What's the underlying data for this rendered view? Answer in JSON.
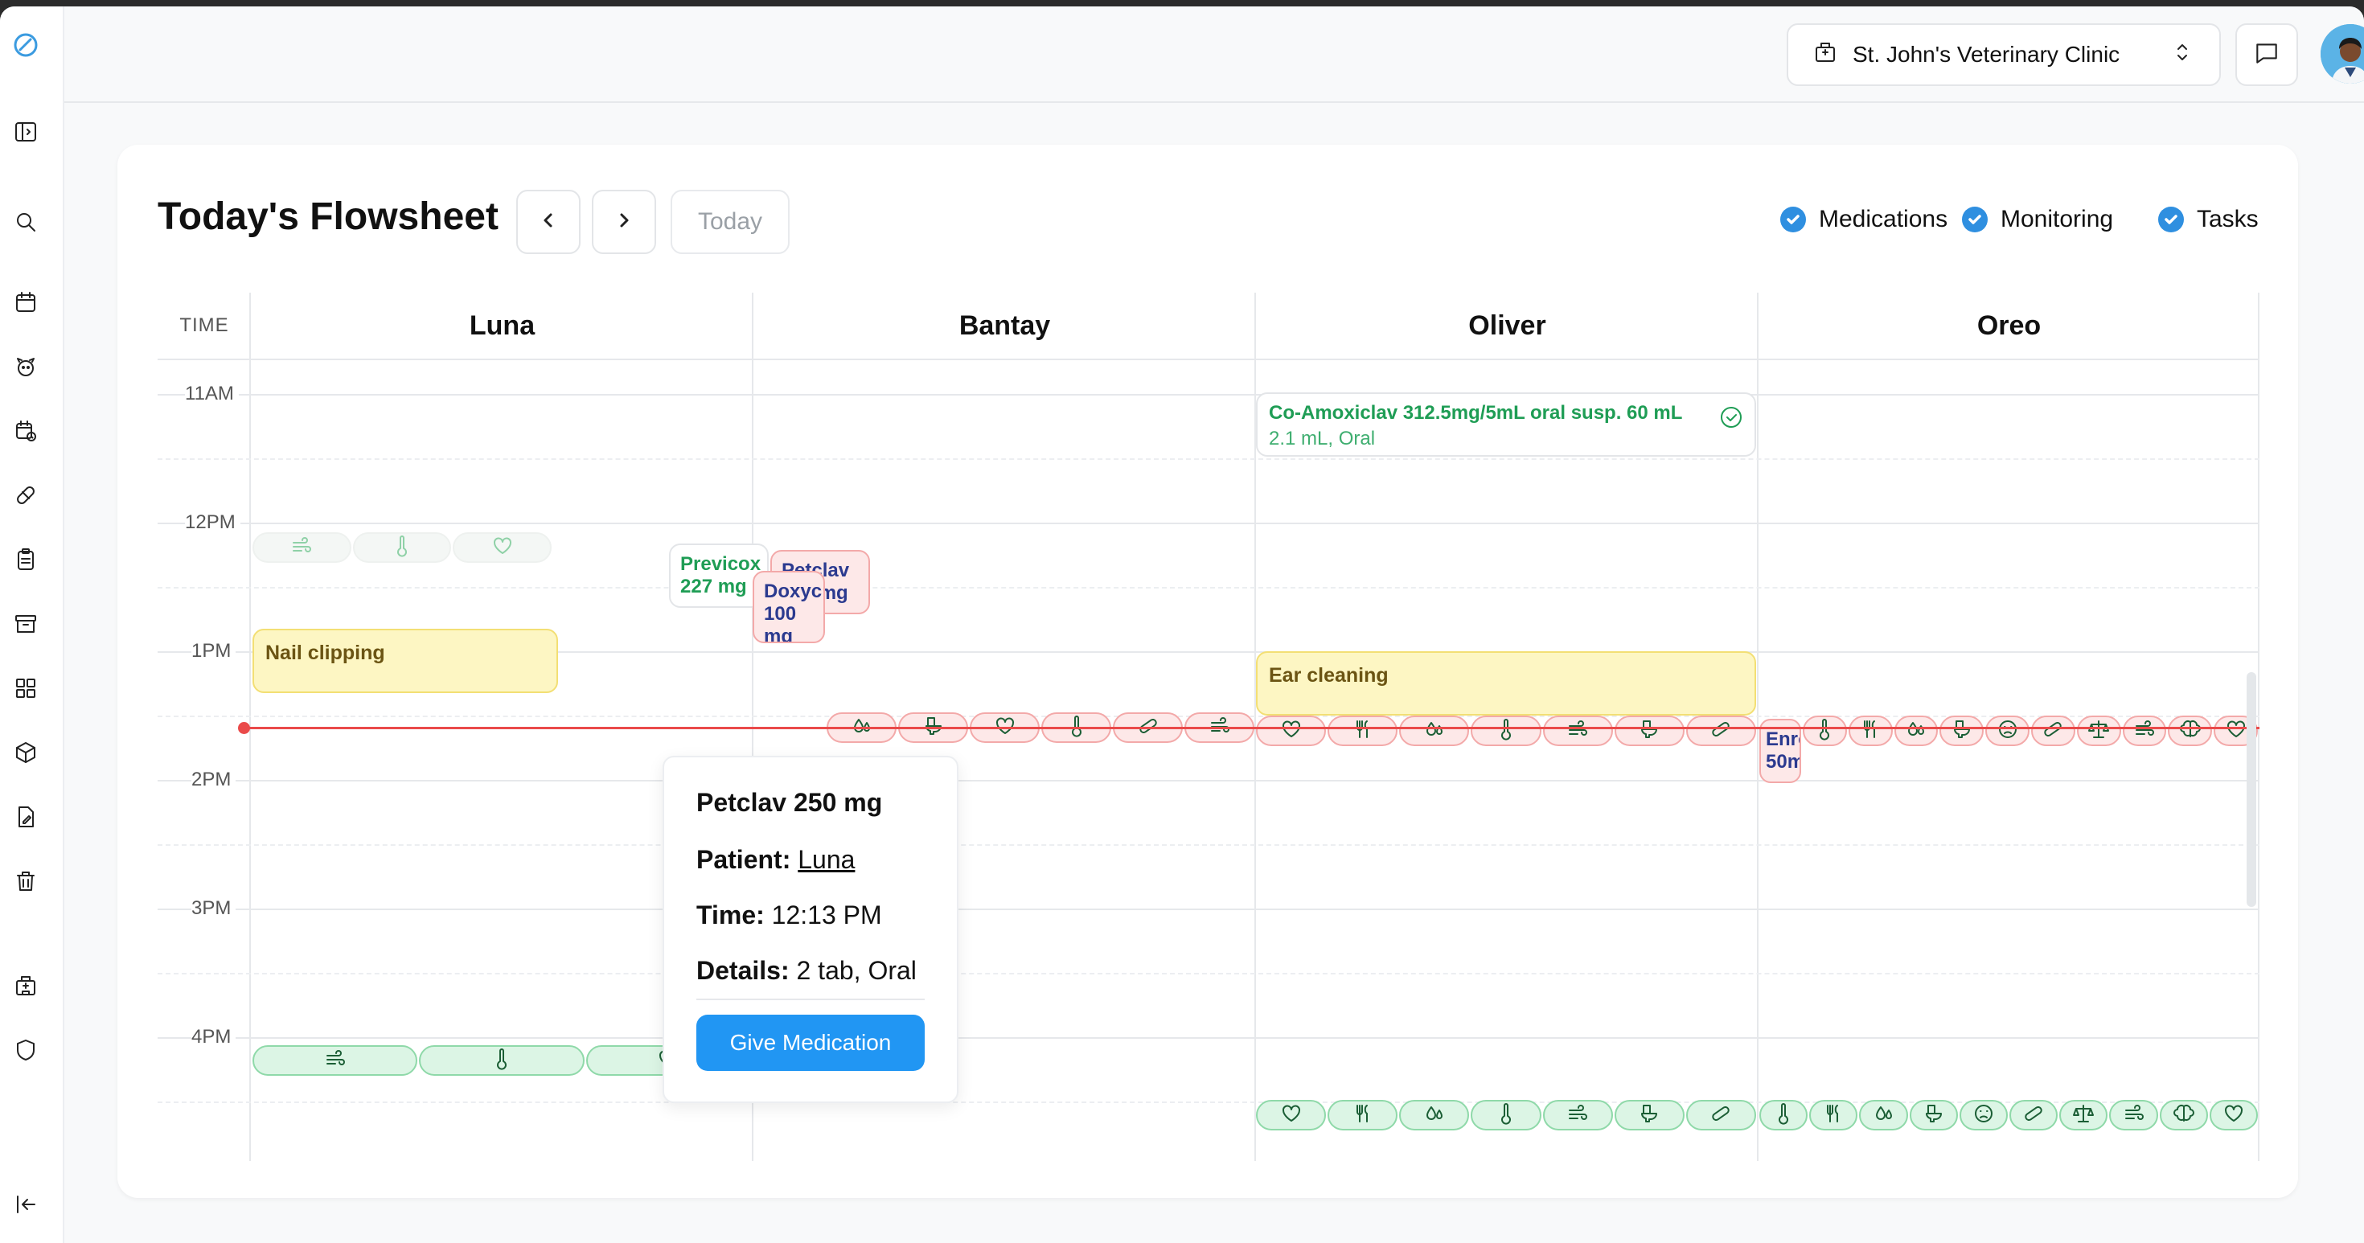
{
  "header": {
    "clinic": "St. John's Veterinary Clinic"
  },
  "page": {
    "title": "Today's Flowsheet",
    "today_label": "Today"
  },
  "filters": [
    {
      "label": "Medications",
      "checked": true
    },
    {
      "label": "Monitoring",
      "checked": true
    },
    {
      "label": "Tasks",
      "checked": true
    }
  ],
  "grid": {
    "time_header": "TIME",
    "patients": [
      "Luna",
      "Bantay",
      "Oliver",
      "Oreo"
    ],
    "times": [
      "11AM",
      "12PM",
      "1PM",
      "2PM",
      "3PM",
      "4PM"
    ]
  },
  "events": {
    "nail_clipping": "Nail clipping",
    "ear_cleaning": "Ear cleaning",
    "coamox_name": "Co-Amoxiclav 312.5mg/5mL oral susp. 60 mL",
    "coamox_detail": "2.1 mL, Oral",
    "previcox_name": "Previcox",
    "previcox_dose": "227 mg",
    "petclav_name": "Petclav",
    "petclav_dose": "250 mg",
    "doxy_name": "Doxyc",
    "doxy_dose": "100 mg",
    "enro_name": "Enro",
    "enro_dose": "50m"
  },
  "popover": {
    "title": "Petclav 250 mg",
    "patient_label": "Patient:",
    "patient_value": "Luna",
    "time_label": "Time:",
    "time_value": "12:13 PM",
    "details_label": "Details:",
    "details_value": "2 tab, Oral",
    "button": "Give Medication"
  },
  "colors": {
    "accent": "#2196f3",
    "now_line": "#ea4a4a",
    "task_bg": "#fdf6c3",
    "overdue_bg": "#fde8e8",
    "done_bg": "#dcf5e5"
  },
  "icons": {
    "sidebar": [
      "logo-icon",
      "sidebar-toggle-icon",
      "search-icon",
      "calendar-icon",
      "pet-icon",
      "schedule-icon",
      "pill-icon",
      "clipboard-icon",
      "archive-icon",
      "dashboard-icon",
      "box-icon",
      "file-edit-icon",
      "trash-icon",
      "building-icon",
      "shield-icon",
      "collapse-icon"
    ]
  }
}
